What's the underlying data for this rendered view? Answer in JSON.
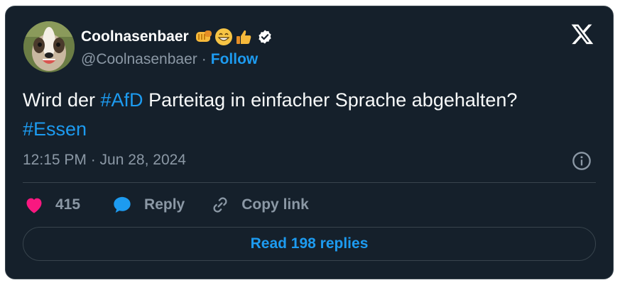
{
  "tweet": {
    "author": {
      "display_name": "Coolnasenbaer",
      "name_emojis": [
        "fist-emoji",
        "grin-emoji",
        "thumbs-up-emoji"
      ],
      "handle": "@Coolnasenbaer",
      "separator": "·",
      "follow_label": "Follow",
      "verified": true
    },
    "text": {
      "part1": "Wird der ",
      "hashtag1": "#AfD",
      "part2": " Parteitag in einfacher Sprache abgehalten?",
      "hashtag2": "#Essen"
    },
    "timestamp": "12:15 PM · Jun 28, 2024",
    "actions": {
      "like_count": "415",
      "reply_label": "Reply",
      "copy_label": "Copy link"
    },
    "read_replies_label": "Read 198 replies"
  },
  "colors": {
    "background": "#15202b",
    "border": "#38444d",
    "accent": "#1d9bf0",
    "muted": "#8b98a5",
    "like": "#f91880"
  },
  "icons": [
    "x-logo-icon",
    "verified-badge-icon",
    "info-icon",
    "heart-icon",
    "reply-bubble-icon",
    "link-icon"
  ]
}
